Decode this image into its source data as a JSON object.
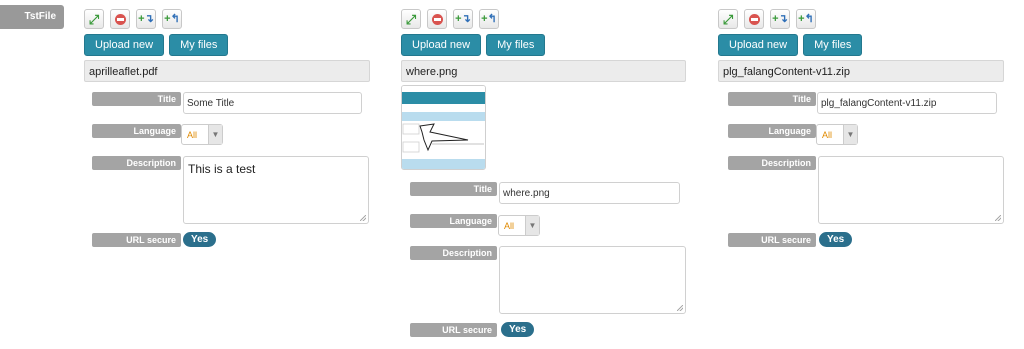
{
  "field": {
    "label": "TstFile"
  },
  "toolbar": {
    "upload_label": "Upload new",
    "myfiles_label": "My files",
    "icons": [
      "expand-icon",
      "remove-icon",
      "add-after-icon",
      "add-before-icon"
    ]
  },
  "form_labels": {
    "title": "Title",
    "language": "Language",
    "description": "Description",
    "url_secure": "URL secure"
  },
  "colors": {
    "accent": "#2b8da6",
    "pill": "#2b6f8c",
    "language_value": "#e08a00"
  },
  "items": [
    {
      "filename": "aprilleaflet.pdf",
      "title_value": "Some Title",
      "language_value": "All",
      "description_value": "This is a test",
      "url_secure_value": "Yes"
    },
    {
      "filename": "where.png",
      "title_value": "where.png",
      "language_value": "All",
      "description_value": "",
      "url_secure_value": "Yes"
    },
    {
      "filename": "plg_falangContent-v11.zip",
      "title_value": "plg_falangContent-v11.zip",
      "language_value": "All",
      "description_value": "",
      "url_secure_value": "Yes"
    }
  ]
}
